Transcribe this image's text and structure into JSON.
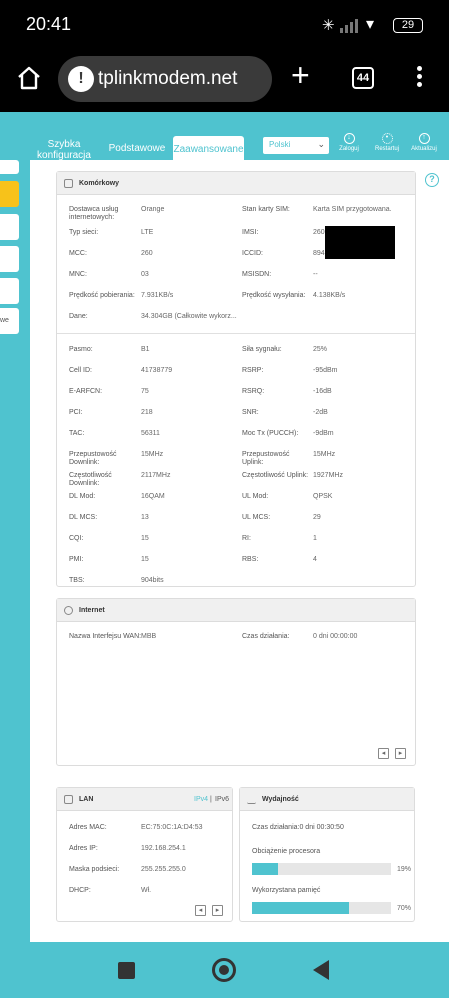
{
  "status_bar": {
    "time": "20:41",
    "battery": "29"
  },
  "browser": {
    "url": "tplinkmodem.net",
    "tab_count": "44"
  },
  "nav": {
    "tabs": [
      {
        "label": "Szybka konfiguracja"
      },
      {
        "label": "Podstawowe"
      },
      {
        "label": "Zaawansowane"
      }
    ],
    "language": "Polski",
    "actions": [
      {
        "label": "Zaloguj",
        "icon": "download-icon"
      },
      {
        "label": "Restartuj",
        "icon": "restart-icon"
      },
      {
        "label": "Aktualizuj",
        "icon": "upload-icon"
      }
    ],
    "sidebar_partial_label": "we"
  },
  "cellular": {
    "title": "Komórkowy",
    "rows1": [
      {
        "l1": "Dostawca usług internetowych:",
        "v1": "Orange",
        "l2": "Stan karty SIM:",
        "v2": "Karta SIM przygotowana."
      },
      {
        "l1": "Typ sieci:",
        "v1": "LTE",
        "l2": "IMSI:",
        "v2": "260"
      },
      {
        "l1": "MCC:",
        "v1": "260",
        "l2": "ICCID:",
        "v2": "894"
      },
      {
        "l1": "MNC:",
        "v1": "03",
        "l2": "MSISDN:",
        "v2": "--"
      },
      {
        "l1": "Prędkość pobierania:",
        "v1": "7.931KB/s",
        "l2": "Prędkość wysyłania:",
        "v2": "4.138KB/s"
      },
      {
        "l1": "Dane:",
        "v1": "34.304GB (Całkowite wykorz...",
        "l2": "",
        "v2": ""
      }
    ],
    "rows2": [
      {
        "l1": "Pasmo:",
        "v1": "B1",
        "l2": "Siła sygnału:",
        "v2": "25%"
      },
      {
        "l1": "Cell ID:",
        "v1": "41738779",
        "l2": "RSRP:",
        "v2": "-95dBm"
      },
      {
        "l1": "E-ARFCN:",
        "v1": "75",
        "l2": "RSRQ:",
        "v2": "-16dB"
      },
      {
        "l1": "PCI:",
        "v1": "218",
        "l2": "SNR:",
        "v2": "-2dB"
      },
      {
        "l1": "TAC:",
        "v1": "56311",
        "l2": "Moc Tx (PUCCH):",
        "v2": "-9dBm"
      },
      {
        "l1": "Przepustowość Downlink:",
        "v1": "15MHz",
        "l2": "Przepustowość Uplink:",
        "v2": "15MHz"
      },
      {
        "l1": "Częstotliwość Downlink:",
        "v1": "2117MHz",
        "l2": "Częstotliwość Uplink:",
        "v2": "1927MHz"
      },
      {
        "l1": "DL Mod:",
        "v1": "16QAM",
        "l2": "UL Mod:",
        "v2": "QPSK"
      },
      {
        "l1": "DL MCS:",
        "v1": "13",
        "l2": "UL MCS:",
        "v2": "29"
      },
      {
        "l1": "CQI:",
        "v1": "15",
        "l2": "RI:",
        "v2": "1"
      },
      {
        "l1": "PMI:",
        "v1": "15",
        "l2": "RBS:",
        "v2": "4"
      },
      {
        "l1": "TBS:",
        "v1": "904bits",
        "l2": "",
        "v2": ""
      }
    ]
  },
  "internet": {
    "title": "Internet",
    "iface_label": "Nazwa Interfejsu WAN:",
    "iface_value": "MBB",
    "uptime_label": "Czas działania:",
    "uptime_value": "0 dni 00:00:00"
  },
  "lan": {
    "title": "LAN",
    "ipv4": "IPv4",
    "sep": "|",
    "ipv6": "IPv6",
    "rows": [
      {
        "label": "Adres MAC:",
        "value": "EC:75:0C:1A:D4:53"
      },
      {
        "label": "Adres IP:",
        "value": "192.168.254.1"
      },
      {
        "label": "Maska podsieci:",
        "value": "255.255.255.0"
      },
      {
        "label": "DHCP:",
        "value": "Wł."
      }
    ]
  },
  "performance": {
    "title": "Wydajność",
    "uptime": "Czas działania:0 dni 00:30:50",
    "cpu_label": "Obciążenie procesora",
    "cpu_value": "19%",
    "cpu_fraction": 0.19,
    "mem_label": "Wykorzystana pamięć",
    "mem_value": "70%",
    "mem_fraction": 0.7
  },
  "colors": {
    "accent": "#4fc3cf",
    "sidebar_active": "#f7c21a"
  }
}
